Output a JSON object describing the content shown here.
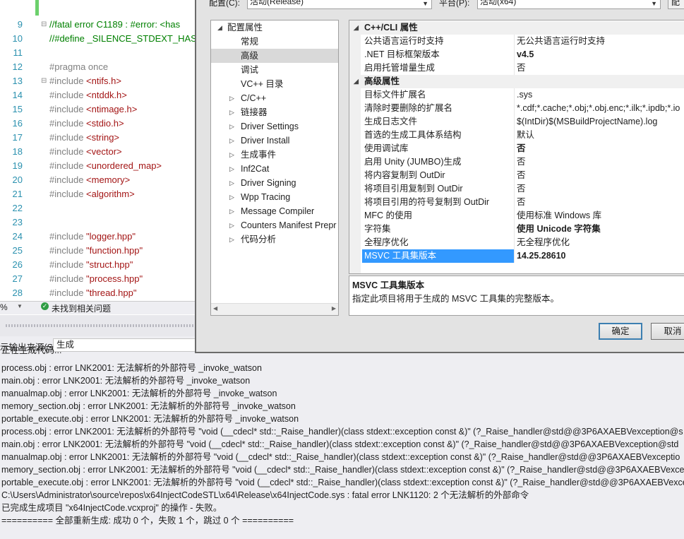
{
  "editor": {
    "lines": [
      {
        "n": "9",
        "code": "//fatal error C1189 : #error:  <has",
        "cls": "cmt",
        "fold": "⊟"
      },
      {
        "n": "10",
        "code": "//#define _SILENCE_STDEXT_HAS",
        "cls": "cmt",
        "fold": ""
      },
      {
        "n": "11",
        "code": "",
        "cls": "",
        "fold": ""
      },
      {
        "n": "12",
        "code": "#pragma once",
        "cls": "pp",
        "fold": ""
      },
      {
        "n": "13",
        "code": "#include <ntifs.h>",
        "cls": "inc",
        "fold": "⊟"
      },
      {
        "n": "14",
        "code": "#include <ntddk.h>",
        "cls": "inc",
        "fold": ""
      },
      {
        "n": "15",
        "code": "#include <ntimage.h>",
        "cls": "inc",
        "fold": ""
      },
      {
        "n": "16",
        "code": "#include <stdio.h>",
        "cls": "inc",
        "fold": ""
      },
      {
        "n": "17",
        "code": "#include <string>",
        "cls": "inc",
        "fold": ""
      },
      {
        "n": "18",
        "code": "#include <vector>",
        "cls": "inc",
        "fold": ""
      },
      {
        "n": "19",
        "code": "#include <unordered_map>",
        "cls": "inc",
        "fold": ""
      },
      {
        "n": "20",
        "code": "#include <memory>",
        "cls": "inc",
        "fold": ""
      },
      {
        "n": "21",
        "code": "#include <algorithm>",
        "cls": "inc",
        "fold": ""
      },
      {
        "n": "22",
        "code": "",
        "cls": "",
        "fold": ""
      },
      {
        "n": "23",
        "code": "",
        "cls": "",
        "fold": ""
      },
      {
        "n": "24",
        "code": "#include  \"logger.hpp\"",
        "cls": "inc",
        "fold": ""
      },
      {
        "n": "25",
        "code": "#include \"function.hpp\"",
        "cls": "inc",
        "fold": ""
      },
      {
        "n": "26",
        "code": "#include \"struct.hpp\"",
        "cls": "inc",
        "fold": ""
      },
      {
        "n": "27",
        "code": "#include \"process.hpp\"",
        "cls": "inc",
        "fold": ""
      },
      {
        "n": "28",
        "code": "#include \"thread.hpp\"",
        "cls": "inc",
        "fold": ""
      }
    ],
    "status": {
      "zoom": "%",
      "message": "未找到相关问题"
    }
  },
  "output": {
    "source_label": "示输出来源(S):",
    "source_value": "生成",
    "lines": [
      "正在生成代码...",
      "process.obj : error LNK2001: 无法解析的外部符号 _invoke_watson",
      "main.obj : error LNK2001: 无法解析的外部符号 _invoke_watson",
      "manualmap.obj : error LNK2001: 无法解析的外部符号 _invoke_watson",
      "memory_section.obj : error LNK2001: 无法解析的外部符号 _invoke_watson",
      "portable_execute.obj : error LNK2001: 无法解析的外部符号 _invoke_watson",
      "process.obj : error LNK2001: 无法解析的外部符号 \"void (__cdecl* std::_Raise_handler)(class stdext::exception const &)\" (?_Raise_handler@std@@3P6AXAEBVexception@s",
      "main.obj : error LNK2001: 无法解析的外部符号 \"void (__cdecl* std::_Raise_handler)(class stdext::exception const &)\" (?_Raise_handler@std@@3P6AXAEBVexception@std",
      "manualmap.obj : error LNK2001: 无法解析的外部符号 \"void (__cdecl* std::_Raise_handler)(class stdext::exception const &)\" (?_Raise_handler@std@@3P6AXAEBVexceptio",
      "memory_section.obj : error LNK2001: 无法解析的外部符号 \"void (__cdecl* std::_Raise_handler)(class stdext::exception const &)\" (?_Raise_handler@std@@3P6AXAEBVexce",
      "portable_execute.obj : error LNK2001: 无法解析的外部符号 \"void (__cdecl* std::_Raise_handler)(class stdext::exception const &)\" (?_Raise_handler@std@@3P6AXAEBVexce",
      "C:\\Users\\Administrator\\source\\repos\\x64InjectCodeSTL\\x64\\Release\\x64InjectCode.sys : fatal error LNK1120: 2 个无法解析的外部命令",
      "已完成生成项目 \"x64InjectCode.vcxproj\" 的操作 - 失败。",
      "========== 全部重新生成: 成功 0 个，失败 1 个，跳过 0 个 =========="
    ]
  },
  "dialog": {
    "config_label": "配置(C):",
    "config_value": "活动(Release)",
    "platform_label": "平台(P):",
    "platform_value": "活动(x64)",
    "manager_label": "配",
    "tree": [
      {
        "label": "配置属性",
        "indent": 0,
        "arrow": "◢",
        "sel": false
      },
      {
        "label": "常规",
        "indent": 1,
        "arrow": "",
        "sel": false
      },
      {
        "label": "高级",
        "indent": 1,
        "arrow": "",
        "sel": true
      },
      {
        "label": "调试",
        "indent": 1,
        "arrow": "",
        "sel": false
      },
      {
        "label": "VC++ 目录",
        "indent": 1,
        "arrow": "",
        "sel": false
      },
      {
        "label": "C/C++",
        "indent": 1,
        "arrow": "▷",
        "sel": false
      },
      {
        "label": "链接器",
        "indent": 1,
        "arrow": "▷",
        "sel": false
      },
      {
        "label": "Driver Settings",
        "indent": 1,
        "arrow": "▷",
        "sel": false
      },
      {
        "label": "Driver Install",
        "indent": 1,
        "arrow": "▷",
        "sel": false
      },
      {
        "label": "生成事件",
        "indent": 1,
        "arrow": "▷",
        "sel": false
      },
      {
        "label": "Inf2Cat",
        "indent": 1,
        "arrow": "▷",
        "sel": false
      },
      {
        "label": "Driver Signing",
        "indent": 1,
        "arrow": "▷",
        "sel": false
      },
      {
        "label": "Wpp Tracing",
        "indent": 1,
        "arrow": "▷",
        "sel": false
      },
      {
        "label": "Message Compiler",
        "indent": 1,
        "arrow": "▷",
        "sel": false
      },
      {
        "label": "Counters Manifest Prepr",
        "indent": 1,
        "arrow": "▷",
        "sel": false
      },
      {
        "label": "代码分析",
        "indent": 1,
        "arrow": "▷",
        "sel": false
      }
    ],
    "grid": [
      {
        "cat": true,
        "key": "C++/CLI 属性",
        "value": "",
        "bold": false,
        "sel": false
      },
      {
        "cat": false,
        "key": "公共语言运行时支持",
        "value": "无公共语言运行时支持",
        "bold": false,
        "sel": false
      },
      {
        "cat": false,
        "key": ".NET 目标框架版本",
        "value": "v4.5",
        "bold": true,
        "sel": false
      },
      {
        "cat": false,
        "key": "启用托管增量生成",
        "value": "否",
        "bold": false,
        "sel": false
      },
      {
        "cat": true,
        "key": "高级属性",
        "value": "",
        "bold": false,
        "sel": false
      },
      {
        "cat": false,
        "key": "目标文件扩展名",
        "value": ".sys",
        "bold": false,
        "sel": false
      },
      {
        "cat": false,
        "key": "清除时要删除的扩展名",
        "value": "*.cdf;*.cache;*.obj;*.obj.enc;*.ilk;*.ipdb;*.io",
        "bold": false,
        "sel": false
      },
      {
        "cat": false,
        "key": "生成日志文件",
        "value": "$(IntDir)$(MSBuildProjectName).log",
        "bold": false,
        "sel": false
      },
      {
        "cat": false,
        "key": "首选的生成工具体系结构",
        "value": "默认",
        "bold": false,
        "sel": false
      },
      {
        "cat": false,
        "key": "使用调试库",
        "value": "否",
        "bold": true,
        "sel": false
      },
      {
        "cat": false,
        "key": "启用 Unity (JUMBO)生成",
        "value": "否",
        "bold": false,
        "sel": false
      },
      {
        "cat": false,
        "key": "将内容复制到 OutDir",
        "value": "否",
        "bold": false,
        "sel": false
      },
      {
        "cat": false,
        "key": "将项目引用复制到 OutDir",
        "value": "否",
        "bold": false,
        "sel": false
      },
      {
        "cat": false,
        "key": "将项目引用的符号复制到 OutDir",
        "value": "否",
        "bold": false,
        "sel": false
      },
      {
        "cat": false,
        "key": "MFC 的使用",
        "value": "使用标准 Windows 库",
        "bold": false,
        "sel": false
      },
      {
        "cat": false,
        "key": "字符集",
        "value": "使用 Unicode 字符集",
        "bold": true,
        "sel": false
      },
      {
        "cat": false,
        "key": "全程序优化",
        "value": "无全程序优化",
        "bold": false,
        "sel": false
      },
      {
        "cat": false,
        "key": "MSVC 工具集版本",
        "value": "14.25.28610",
        "bold": true,
        "sel": true
      }
    ],
    "description": {
      "title": "MSVC 工具集版本",
      "body": "指定此项目将用于生成的 MSVC 工具集的完整版本。"
    },
    "ok_label": "确定",
    "cancel_label": "取消"
  }
}
